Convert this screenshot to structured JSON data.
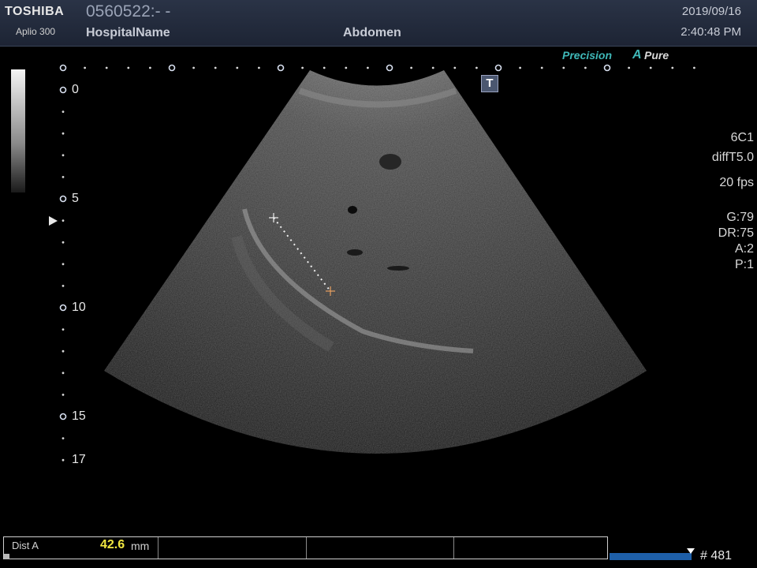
{
  "header": {
    "brand": "TOSHIBA",
    "model": "Aplio 300",
    "patient_id": "0560522:- -",
    "hospital": "HospitalName",
    "exam": "Abdomen",
    "date": "2019/09/16",
    "time": "2:40:48 PM"
  },
  "logos": {
    "precision": "Precision",
    "apure_a": "A",
    "apure": "Pure"
  },
  "t_badge": "T",
  "depth_scale": [
    {
      "label": "0",
      "depth": 0
    },
    {
      "label": "5",
      "depth": 5
    },
    {
      "label": "10",
      "depth": 10
    },
    {
      "label": "15",
      "depth": 15
    },
    {
      "label": "17",
      "depth": 17
    }
  ],
  "params": {
    "probe": "6C1",
    "mode": "diffT5.0",
    "fps": "20 fps",
    "gain": "G:79",
    "dr": "DR:75",
    "a": "A:2",
    "p": "P:1"
  },
  "measurement": {
    "name": "Dist A",
    "value": "42.6",
    "unit": "mm"
  },
  "cine": {
    "frame": "# 481",
    "progress": 0.95
  },
  "colors": {
    "header_bg": "#1d2434",
    "accent_teal": "#3fb8b8",
    "measure_yellow": "#f0e640",
    "cine_blue": "#1e5fa8"
  }
}
